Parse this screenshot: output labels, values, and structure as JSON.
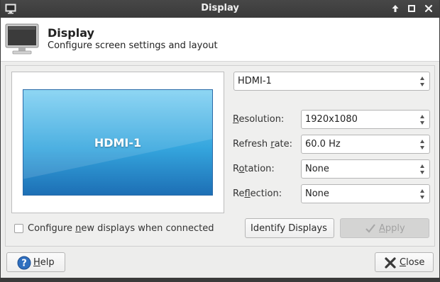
{
  "titlebar": {
    "title": "Display",
    "icons": [
      "display-app-icon",
      "maximize-up-icon",
      "restore-icon",
      "close-icon"
    ]
  },
  "header": {
    "title": "Display",
    "subtitle": "Configure screen settings and layout"
  },
  "preview": {
    "screen_label": "HDMI-1"
  },
  "output_select": {
    "value": "HDMI-1"
  },
  "fields": {
    "resolution": {
      "label_pre": "",
      "label_mn": "R",
      "label_post": "esolution:",
      "value": "1920x1080"
    },
    "refresh_rate": {
      "label_pre": "Refresh ",
      "label_mn": "r",
      "label_post": "ate:",
      "value": "60.0 Hz"
    },
    "rotation": {
      "label_pre": "R",
      "label_mn": "o",
      "label_post": "tation:",
      "value": "None"
    },
    "reflection": {
      "label_pre": "Re",
      "label_mn": "f",
      "label_post": "lection:",
      "value": "None"
    }
  },
  "checkbox": {
    "label_pre": "Configure ",
    "label_mn": "n",
    "label_post": "ew displays when connected",
    "checked": false
  },
  "buttons": {
    "identify": "Identify Displays",
    "apply_mn": "A",
    "apply_post": "pply",
    "help_mn": "H",
    "help_post": "elp",
    "close_mn": "C",
    "close_post": "lose"
  },
  "colors": {
    "titlebar": "#3a3a3a",
    "screen_top": "#7fd0f2",
    "screen_bottom": "#1d6fb5",
    "help_icon": "#2f6fbf"
  }
}
